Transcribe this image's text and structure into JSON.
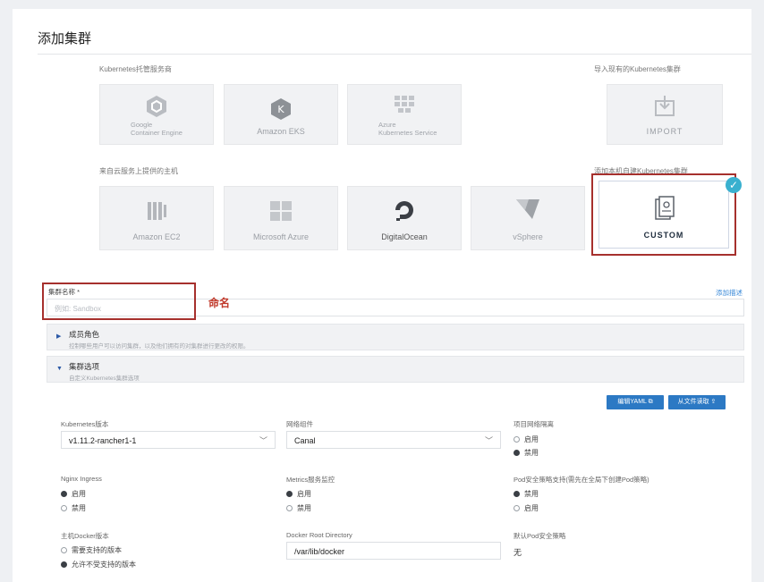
{
  "title": "添加集群",
  "sections": {
    "hosted": "Kubernetes托管服务商",
    "import": "导入现有的Kubernetes集群",
    "cloud": "来自云服务上提供的主机",
    "custom": "添加本机自建Kubernetes集群"
  },
  "providers": {
    "gke": {
      "line1": "Google",
      "line2": "Container Engine"
    },
    "eks": {
      "label": "Amazon EKS"
    },
    "aks": {
      "line1": "Azure",
      "line2": "Kubernetes Service"
    },
    "import": {
      "label": "IMPORT"
    },
    "ec2": {
      "label": "Amazon EC2"
    },
    "azure": {
      "label": "Microsoft Azure"
    },
    "do": {
      "label": "DigitalOcean"
    },
    "vsphere": {
      "label": "vSphere"
    },
    "custom": {
      "label": "CUSTOM"
    }
  },
  "cluster_name": {
    "label": "集群名称 *",
    "placeholder": "例如: Sandbox",
    "annotation": "命名",
    "add_description": "添加描述"
  },
  "member_roles": {
    "title": "成员角色",
    "desc": "控制哪些用户可以访问集群，以及他们拥有的对集群进行更改的权限。"
  },
  "cluster_options": {
    "title": "集群选项",
    "desc": "自定义Kubernetes集群选项",
    "edit_yaml": "编辑YAML",
    "read_file": "从文件读取"
  },
  "form": {
    "k8s_version": {
      "label": "Kubernetes版本",
      "value": "v1.11.2-rancher1-1"
    },
    "network": {
      "label": "网络组件",
      "value": "Canal"
    },
    "isolation": {
      "label": "项目网络隔离",
      "options": [
        "启用",
        "禁用"
      ],
      "selected": 1
    },
    "nginx": {
      "label": "Nginx Ingress",
      "options": [
        "启用",
        "禁用"
      ],
      "selected": 0
    },
    "metrics": {
      "label": "Metrics服务监控",
      "options": [
        "启用",
        "禁用"
      ],
      "selected": 0
    },
    "pod_security": {
      "label": "Pod安全策略支持(需先在全局下创建Pod策略)",
      "options": [
        "禁用",
        "启用"
      ],
      "selected": 0
    },
    "docker_version": {
      "label": "主机Docker版本",
      "options": [
        "需要支持的版本",
        "允许不受支持的版本"
      ],
      "selected": 1
    },
    "docker_root": {
      "label": "Docker Root Directory",
      "value": "/var/lib/docker"
    },
    "default_psp": {
      "label": "默认Pod安全策略",
      "value": "无"
    }
  },
  "colors": {
    "accent": "#2c79c4",
    "highlight": "#a6302d",
    "check": "#39b0cf"
  }
}
